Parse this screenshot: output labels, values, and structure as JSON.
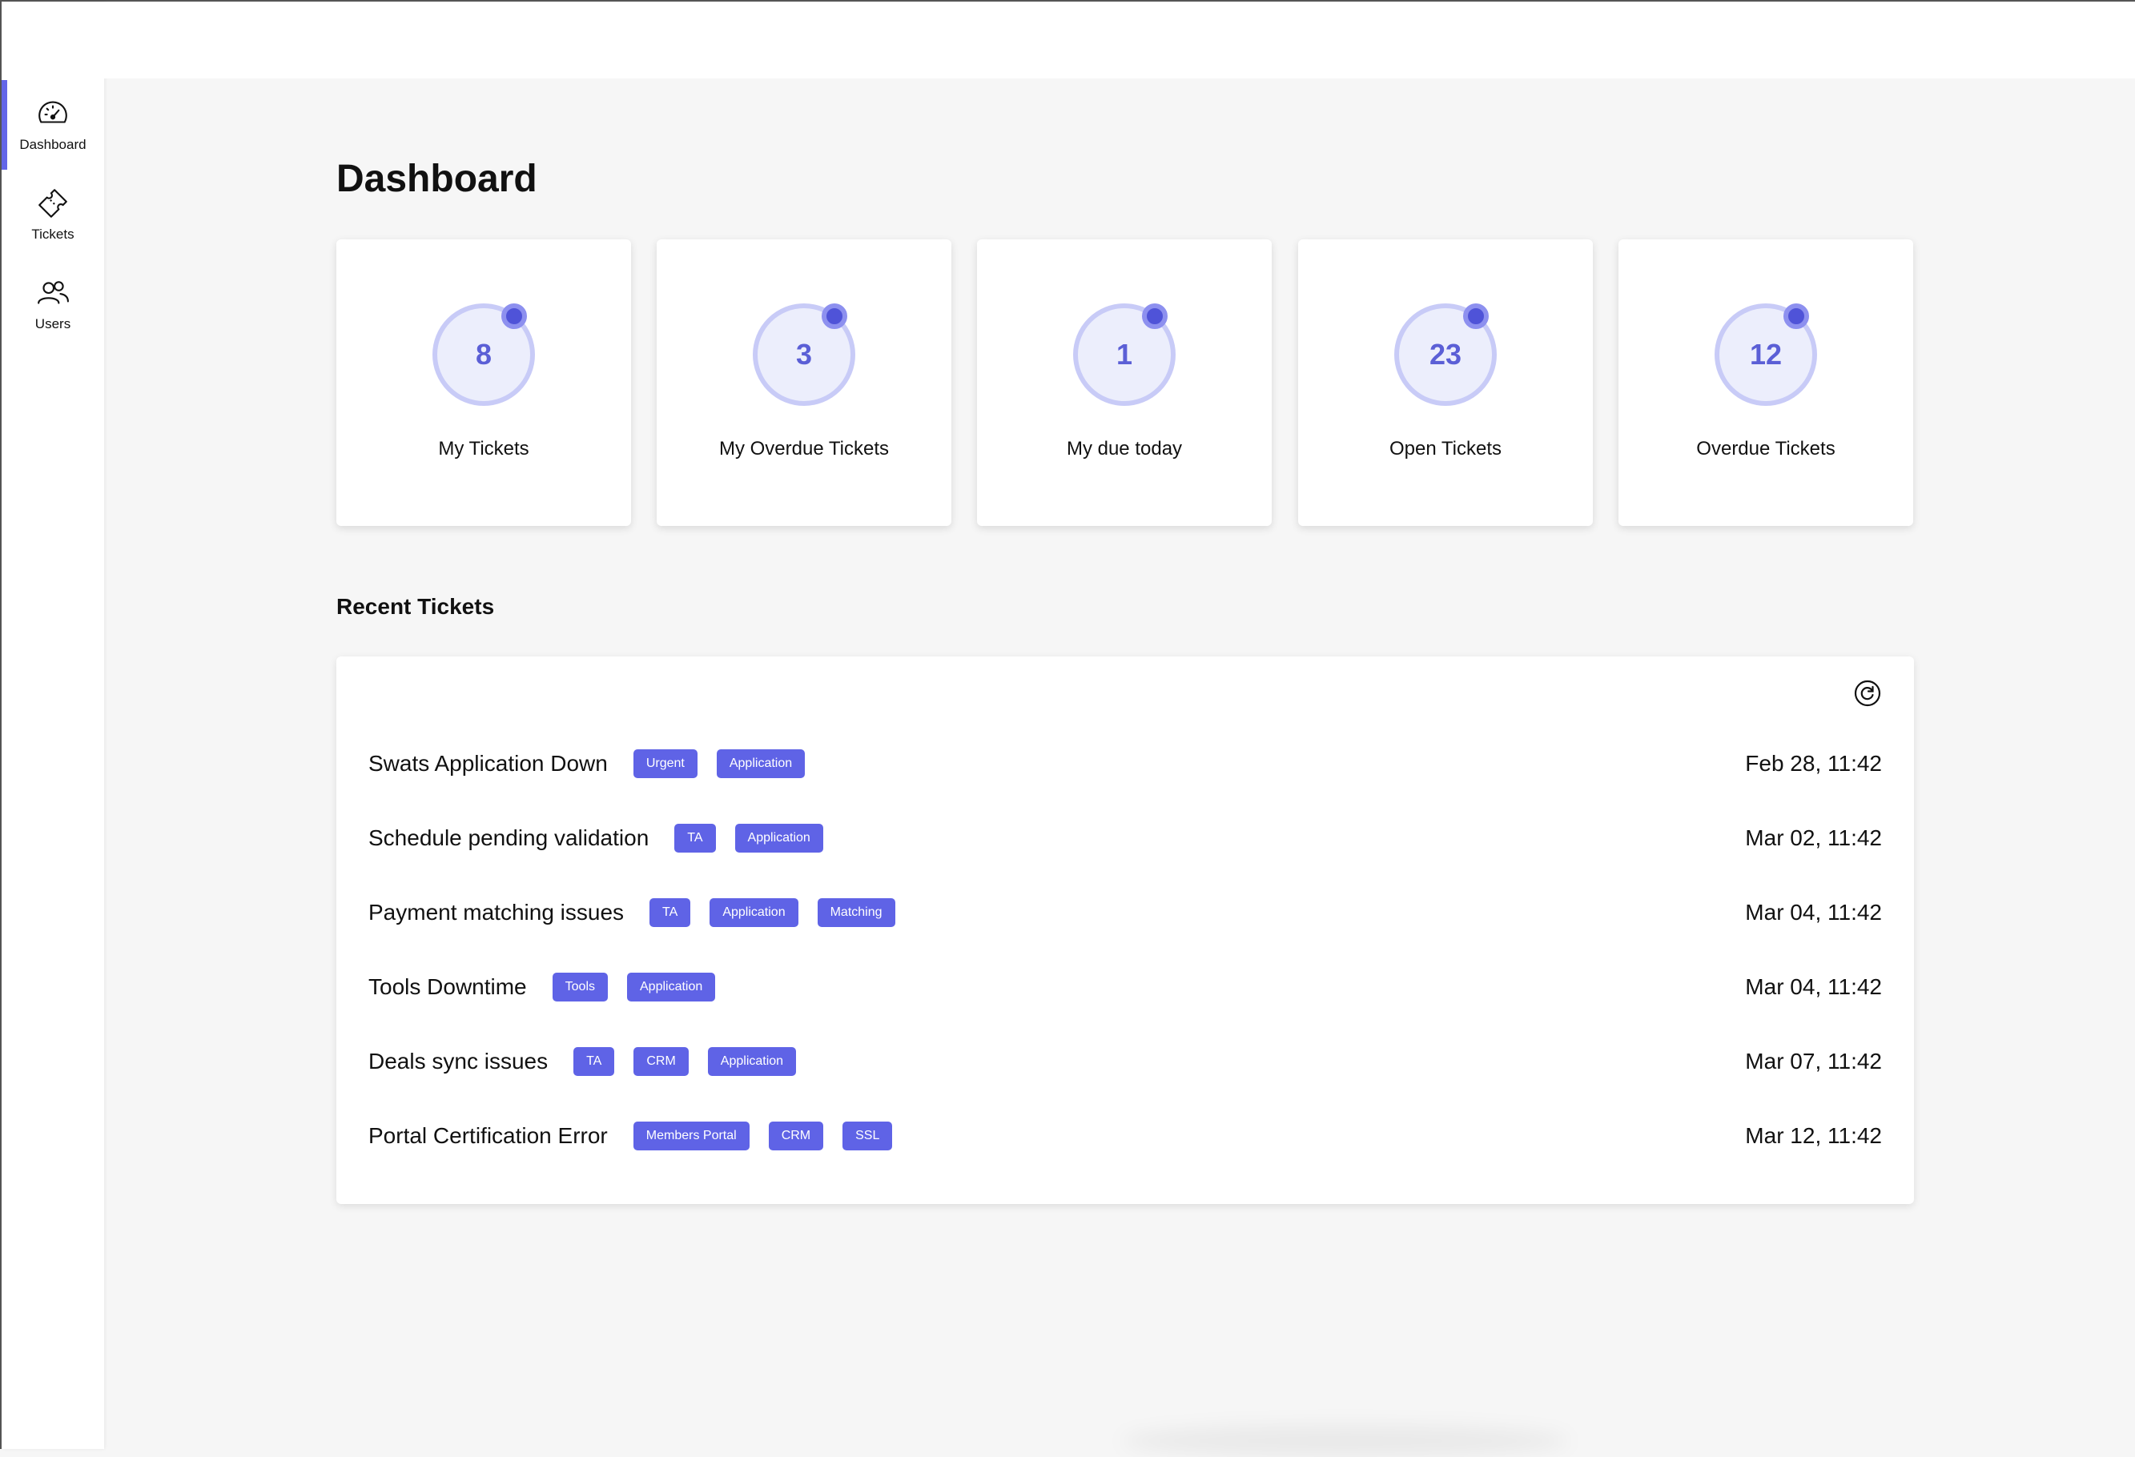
{
  "sidebar": {
    "items": [
      {
        "label": "Dashboard",
        "icon": "speedometer-icon",
        "active": true
      },
      {
        "label": "Tickets",
        "icon": "ticket-icon",
        "active": false
      },
      {
        "label": "Users",
        "icon": "users-icon",
        "active": false
      }
    ]
  },
  "page": {
    "title": "Dashboard"
  },
  "stats": [
    {
      "value": "8",
      "label": "My Tickets"
    },
    {
      "value": "3",
      "label": "My Overdue Tickets"
    },
    {
      "value": "1",
      "label": "My due today"
    },
    {
      "value": "23",
      "label": "Open Tickets"
    },
    {
      "value": "12",
      "label": "Overdue Tickets"
    }
  ],
  "recent": {
    "title": "Recent Tickets",
    "refresh_icon": "refresh-icon",
    "tickets": [
      {
        "title": "Swats Application Down",
        "tags": [
          "Urgent",
          "Application"
        ],
        "date": "Feb 28, 11:42"
      },
      {
        "title": "Schedule pending validation",
        "tags": [
          "TA",
          "Application"
        ],
        "date": "Mar 02, 11:42"
      },
      {
        "title": "Payment matching issues",
        "tags": [
          "TA",
          "Application",
          "Matching"
        ],
        "date": "Mar 04, 11:42"
      },
      {
        "title": "Tools Downtime",
        "tags": [
          "Tools",
          "Application"
        ],
        "date": "Mar 04, 11:42"
      },
      {
        "title": "Deals sync issues",
        "tags": [
          "TA",
          "CRM",
          "Application"
        ],
        "date": "Mar 07, 11:42"
      },
      {
        "title": "Portal Certification Error",
        "tags": [
          "Members Portal",
          "CRM",
          "SSL"
        ],
        "date": "Mar 12, 11:42"
      }
    ]
  },
  "colors": {
    "accent": "#6366e8",
    "tag": "#5f63e6",
    "ring": "#c8cbf7",
    "number": "#5b5fd6"
  }
}
